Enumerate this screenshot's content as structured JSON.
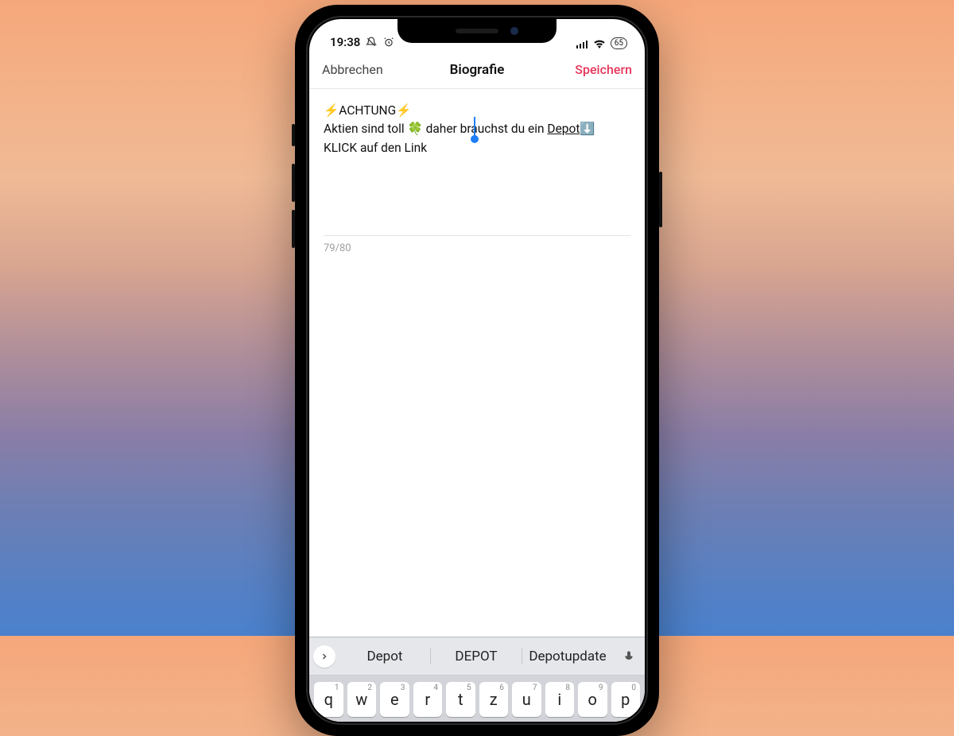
{
  "statusbar": {
    "time": "19:38",
    "battery": "65"
  },
  "header": {
    "cancel": "Abbrechen",
    "title": "Biografie",
    "save": "Speichern"
  },
  "editor": {
    "line1": "⚡ACHTUNG⚡",
    "line2_pre": "Aktien sind toll 🍀 daher brauchst du ein ",
    "line2_link": "Depot",
    "line2_post": "⬇️",
    "line3": "KLICK auf den Link",
    "char_count": "79/80"
  },
  "keyboard": {
    "suggestions": [
      "Depot",
      "DEPOT",
      "Depotupdate"
    ],
    "row1": [
      {
        "l": "q",
        "n": "1"
      },
      {
        "l": "w",
        "n": "2"
      },
      {
        "l": "e",
        "n": "3"
      },
      {
        "l": "r",
        "n": "4"
      },
      {
        "l": "t",
        "n": "5"
      },
      {
        "l": "z",
        "n": "6"
      },
      {
        "l": "u",
        "n": "7"
      },
      {
        "l": "i",
        "n": "8"
      },
      {
        "l": "o",
        "n": "9"
      },
      {
        "l": "p",
        "n": "0"
      }
    ]
  }
}
